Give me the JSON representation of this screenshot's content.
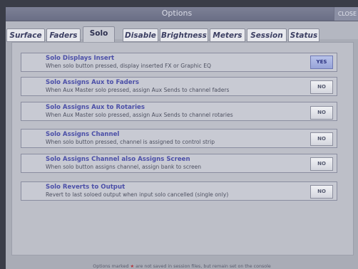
{
  "window": {
    "title": "Options",
    "close_label": "CLOSE"
  },
  "tabs": [
    {
      "label": "Surface"
    },
    {
      "label": "Faders"
    },
    {
      "label": "Solo"
    },
    {
      "label": "Disable"
    },
    {
      "label": "Brightness"
    },
    {
      "label": "Meters"
    },
    {
      "label": "Session"
    },
    {
      "label": "Status"
    }
  ],
  "active_tab": "Solo",
  "options": [
    {
      "title": "Solo Displays Insert",
      "desc": "When solo button pressed, display inserted FX or Graphic EQ",
      "value": "YES"
    },
    {
      "title": "Solo Assigns Aux to Faders",
      "desc": "When Aux Master solo pressed, assign Aux Sends to channel faders",
      "value": "NO"
    },
    {
      "title": "Solo Assigns Aux to Rotaries",
      "desc": "When Aux Master solo pressed, assign Aux Sends to channel rotaries",
      "value": "NO"
    },
    {
      "title": "Solo Assigns Channel",
      "desc": "When solo button pressed, channel is assigned to control strip",
      "value": "NO"
    },
    {
      "title": "Solo Assigns Channel also Assigns Screen",
      "desc": "When solo button assigns channel, assign bank to screen",
      "value": "NO"
    },
    {
      "title": "Solo Reverts to Output",
      "desc": "Revert to last soloed output when input solo cancelled (single only)",
      "value": "NO"
    }
  ],
  "footer": {
    "prefix": "Options marked",
    "star": "★",
    "suffix": "are not saved in session files, but remain set on the console"
  },
  "colors": {
    "accent_title": "#4b4fa8",
    "yes_button": "#a6b1e2",
    "no_button": "#e4e5eb",
    "star": "#b3323a"
  }
}
